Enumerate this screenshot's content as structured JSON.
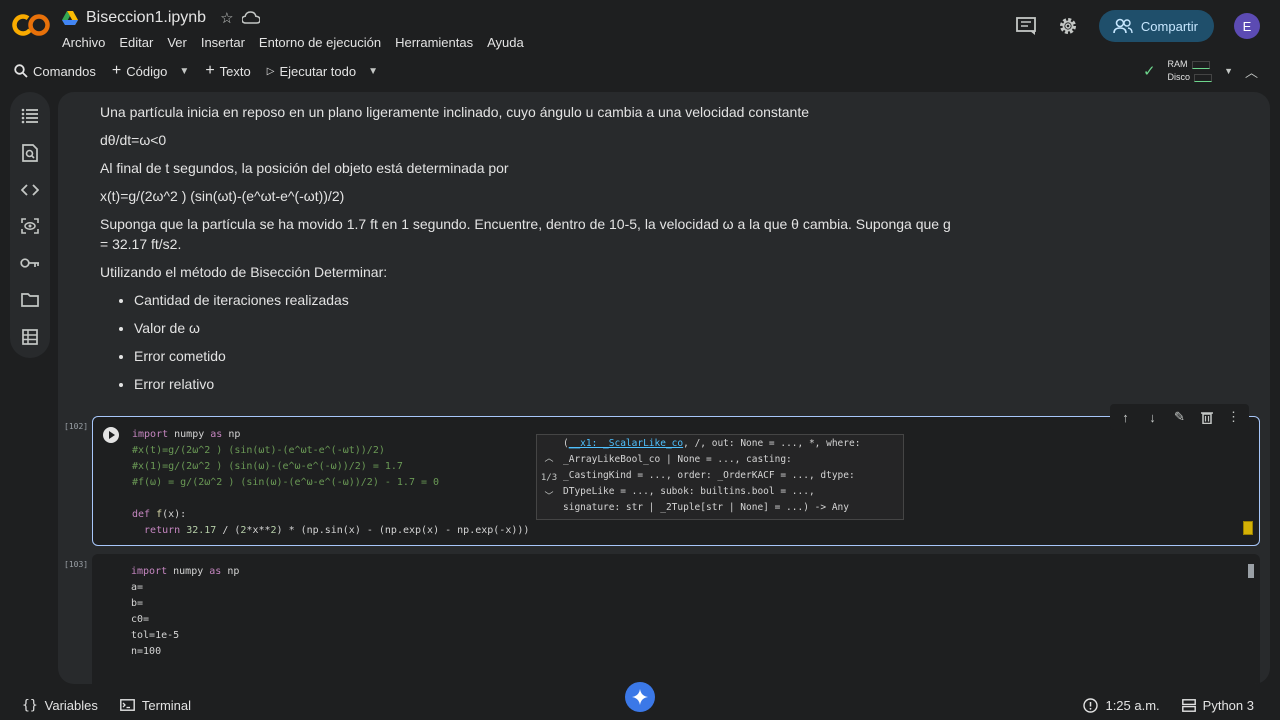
{
  "header": {
    "logo_text": "CO",
    "doc_title": "Biseccion1.ipynb",
    "menu": [
      "Archivo",
      "Editar",
      "Ver",
      "Insertar",
      "Entorno de ejecución",
      "Herramientas",
      "Ayuda"
    ],
    "share_label": "Compartir",
    "avatar_letter": "E"
  },
  "toolbar": {
    "commands": "Comandos",
    "code": "Código",
    "text": "Texto",
    "run_all": "Ejecutar todo",
    "ram": "RAM",
    "disk": "Disco"
  },
  "text_cell": {
    "p1": "Una partícula inicia en reposo en un plano ligeramente inclinado, cuyo ángulo u cambia a una velocidad constante",
    "p2": "dθ/dt=ω<0",
    "p3": "Al final de t segundos, la posición del objeto está determinada por",
    "p4": "x(t)=g/(2ω^2 ) (sin(ωt)-(e^ωt-e^(-ωt))/2)",
    "p5": "Suponga que la partícula se ha movido 1.7 ft en 1 segundo. Encuentre, dentro de 10-5, la velocidad ω a la que θ cambia. Suponga que g = 32.17 ft/s2.",
    "p6": "Utilizando el método de Bisección Determinar:",
    "bullets": [
      "Cantidad de iteraciones realizadas",
      "Valor de ω",
      "Error cometido",
      "Error relativo"
    ]
  },
  "cell1": {
    "exec_count": "[102]",
    "lines": {
      "l1a": "import",
      "l1b": " numpy ",
      "l1c": "as",
      "l1d": " np",
      "l2": "#x(t)=g/(2ω^2 ) (sin(ωt)-(e^ωt-e^(-ωt))/2)",
      "l3": "#x(1)=g/(2ω^2 ) (sin(ω)-(e^ω-e^(-ω))/2) = 1.7",
      "l4": "#f(ω) = g/(2ω^2 ) (sin(ω)-(e^ω-e^(-ω))/2) - 1.7 = 0",
      "l6a": "def",
      "l6b": " f",
      "l6c": "(x):",
      "l7a": "  return ",
      "l7b": "32.17",
      "l7c": " / (",
      "l7d": "2",
      "l7e": "*x**",
      "l7f": "2",
      "l7g": ") * (np.sin(x) - (np.exp(x) - np.exp(-x)))"
    }
  },
  "tooltip": {
    "counter": "1/3",
    "first": "__x1: _ScalarLike_co",
    "line1_rest": ", /, out: None = ..., *, where:",
    "line2": "_ArrayLikeBool_co | None = ..., casting:",
    "line3": "_CastingKind = ..., order: _OrderKACF = ..., dtype:",
    "line4": "DTypeLike = ..., subok: builtins.bool = ...,",
    "line5": "signature: str | _2Tuple[str | None] = ...) -> Any",
    "open_paren": "("
  },
  "cell2": {
    "exec_count": "[103]",
    "l1a": "import",
    "l1b": " numpy ",
    "l1c": "as",
    "l1d": " np",
    "l2": "a=",
    "l3": "b=",
    "l4": "c0=",
    "l5": "tol=1e-5",
    "l6": "n=100"
  },
  "statusbar": {
    "variables": "Variables",
    "terminal": "Terminal",
    "time": "1:25 a.m.",
    "runtime": "Python 3"
  },
  "colors": {
    "accent": "#a8c7fa",
    "logo_orange": "#f9ab00",
    "share_bg": "#1f4f6b"
  }
}
